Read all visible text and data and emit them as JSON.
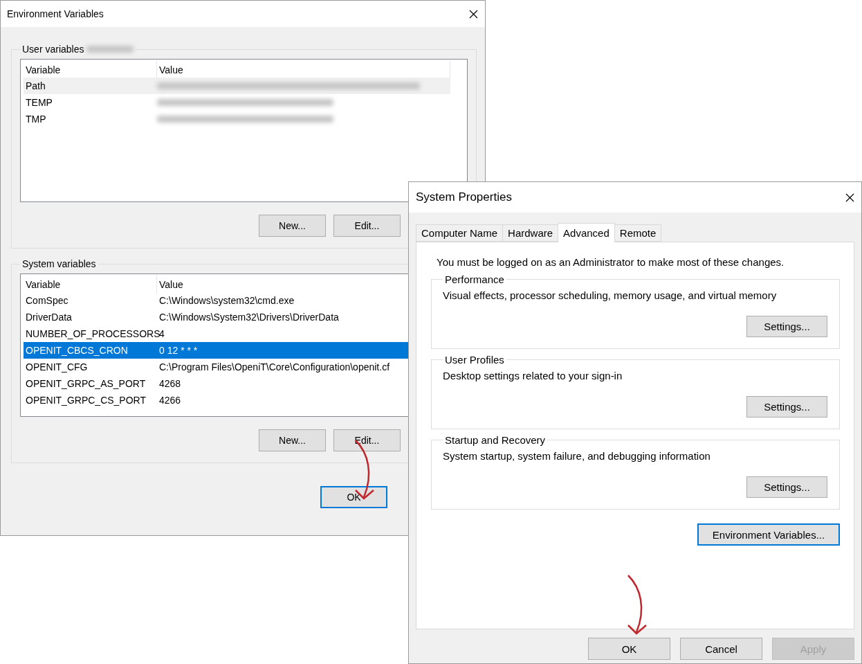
{
  "environment_variables_window": {
    "title": "Environment Variables",
    "user_variables": {
      "label": "User variables",
      "columns": [
        "Variable",
        "Value"
      ],
      "rows": [
        {
          "variable": "Path",
          "highlighted": true,
          "selected": false
        },
        {
          "variable": "TEMP",
          "highlighted": false,
          "selected": false
        },
        {
          "variable": "TMP",
          "highlighted": false,
          "selected": false
        }
      ],
      "buttons": [
        "New...",
        "Edit..."
      ]
    },
    "system_variables": {
      "label": "System variables",
      "columns": [
        "Variable",
        "Value"
      ],
      "rows": [
        {
          "variable": "ComSpec",
          "value": "C:\\Windows\\system32\\cmd.exe",
          "highlighted": false,
          "selected": false
        },
        {
          "variable": "DriverData",
          "value": "C:\\Windows\\System32\\Drivers\\DriverData",
          "highlighted": false,
          "selected": false
        },
        {
          "variable": "NUMBER_OF_PROCESSORS",
          "value": "4",
          "highlighted": false,
          "selected": false
        },
        {
          "variable": "OPENIT_CBCS_CRON",
          "value": "0 12 * * *",
          "highlighted": false,
          "selected": true
        },
        {
          "variable": "OPENIT_CFG",
          "value": "C:\\Program Files\\OpeniT\\Core\\Configuration\\openit.cf",
          "highlighted": false,
          "selected": false
        },
        {
          "variable": "OPENIT_GRPC_AS_PORT",
          "value": "4268",
          "highlighted": false,
          "selected": false
        },
        {
          "variable": "OPENIT_GRPC_CS_PORT",
          "value": "4266",
          "highlighted": false,
          "selected": false
        }
      ],
      "buttons": [
        "New...",
        "Edit..."
      ]
    },
    "buttons": [
      {
        "label": "OK",
        "default": true
      }
    ]
  },
  "system_properties_window": {
    "title": "System Properties",
    "tabs": [
      {
        "label": "Computer Name",
        "selected": false
      },
      {
        "label": "Hardware",
        "selected": false
      },
      {
        "label": "Advanced",
        "selected": true
      },
      {
        "label": "Remote",
        "selected": false
      }
    ],
    "notice": "You must be logged on as an Administrator to make most of these changes.",
    "groups": [
      {
        "title": "Performance",
        "description": "Visual effects, processor scheduling, memory usage, and virtual memory",
        "button": "Settings..."
      },
      {
        "title": "User Profiles",
        "description": "Desktop settings related to your sign-in",
        "button": "Settings..."
      },
      {
        "title": "Startup and Recovery",
        "description": "System startup, system failure, and debugging information",
        "button": "Settings..."
      }
    ],
    "environment_button": {
      "label": "Environment Variables...",
      "default": true
    },
    "buttons": [
      {
        "label": "OK",
        "default": false,
        "disabled": false
      },
      {
        "label": "Cancel",
        "default": false,
        "disabled": false
      },
      {
        "label": "Apply",
        "default": false,
        "disabled": true
      }
    ]
  }
}
